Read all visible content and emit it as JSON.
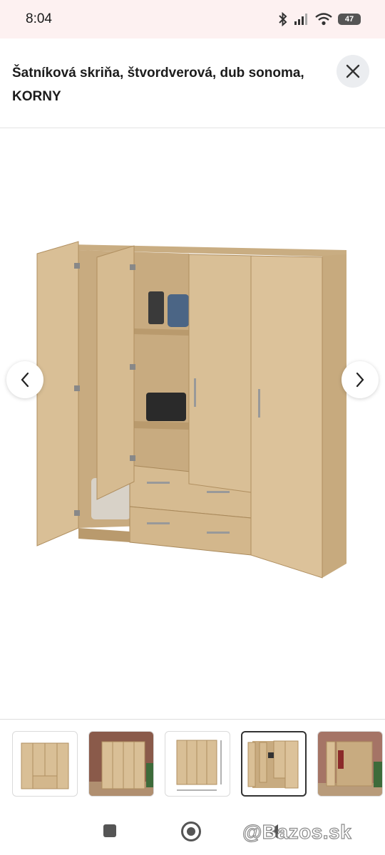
{
  "status_bar": {
    "time": "8:04",
    "battery": "47"
  },
  "header": {
    "title": "Šatníková skriňa, štvordverová, dub sonoma, KORNY"
  },
  "gallery": {
    "prev_glyph": "‹",
    "next_glyph": "›"
  },
  "thumbnails": [
    {
      "label": "thumbnail-1",
      "selected": false
    },
    {
      "label": "thumbnail-2",
      "selected": false
    },
    {
      "label": "thumbnail-3",
      "selected": false
    },
    {
      "label": "thumbnail-4",
      "selected": true
    },
    {
      "label": "thumbnail-5",
      "selected": false
    }
  ],
  "watermark": "@Bazos.sk",
  "colors": {
    "accent_bg": "#fdf1f1",
    "wood": "#d9bf96",
    "wood_dark": "#b99a6d"
  }
}
